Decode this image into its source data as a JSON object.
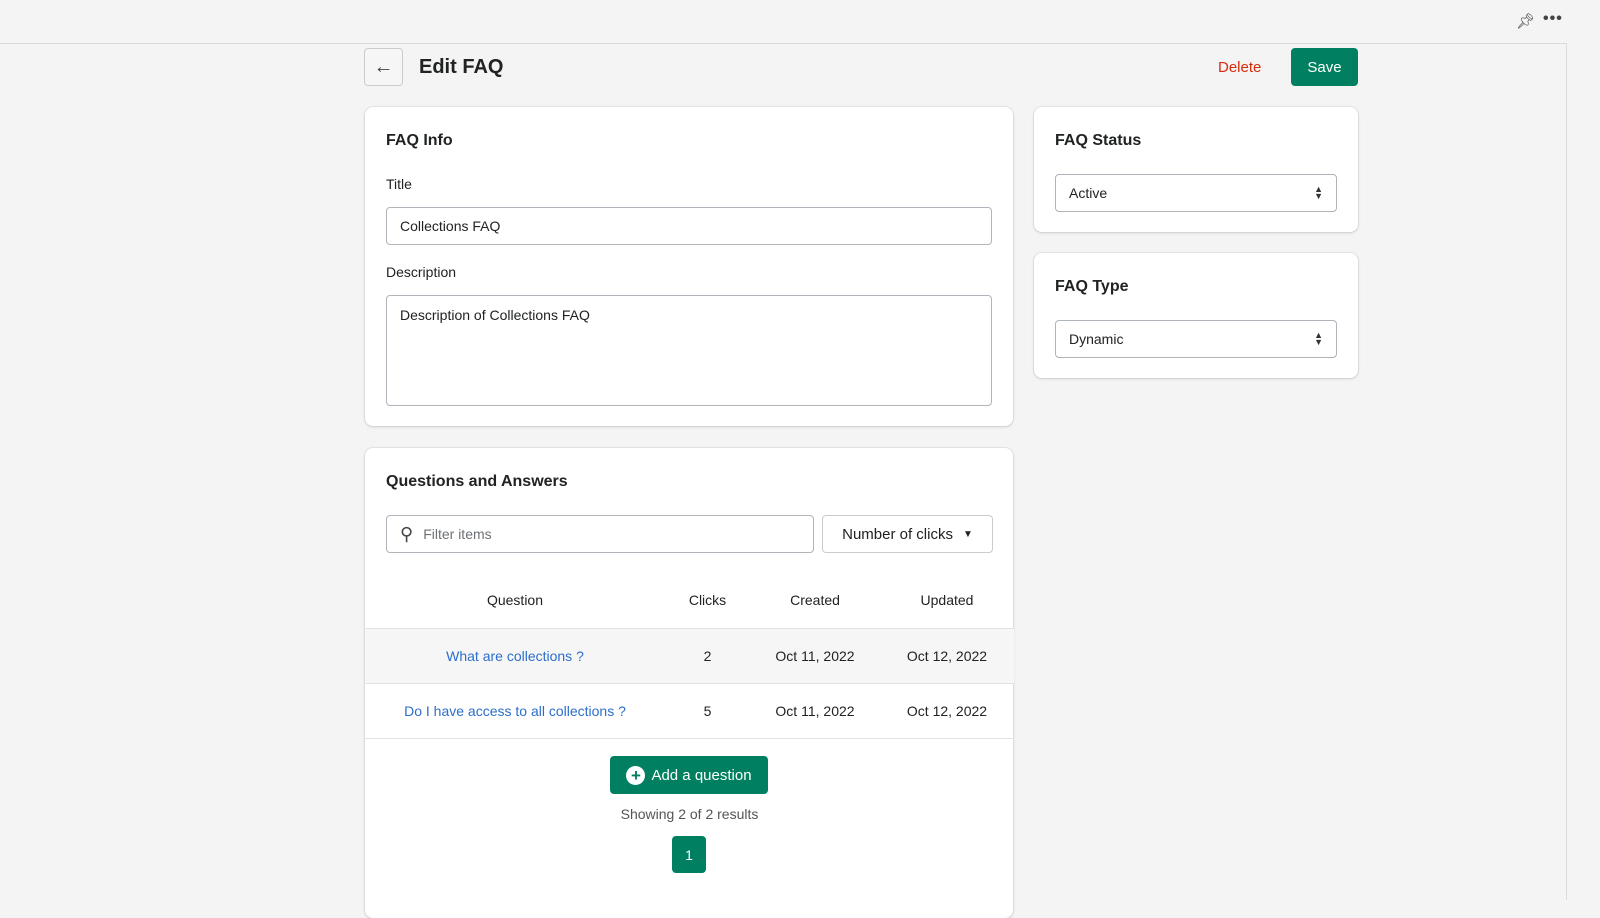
{
  "header": {
    "title": "Edit FAQ",
    "delete_label": "Delete",
    "save_label": "Save"
  },
  "faq_info": {
    "heading": "FAQ Info",
    "title_label": "Title",
    "title_value": "Collections FAQ",
    "description_label": "Description",
    "description_value": "Description of Collections FAQ"
  },
  "status": {
    "heading": "FAQ Status",
    "value": "Active"
  },
  "type": {
    "heading": "FAQ Type",
    "value": "Dynamic"
  },
  "qa": {
    "heading": "Questions and Answers",
    "filter_placeholder": "Filter items",
    "sort_label": "Number of clicks",
    "columns": [
      "Question",
      "Clicks",
      "Created",
      "Updated"
    ],
    "rows": [
      {
        "question": "What are collections ?",
        "clicks": "2",
        "created": "Oct 11, 2022",
        "updated": "Oct 12, 2022"
      },
      {
        "question": "Do I have access to all collections ?",
        "clicks": "5",
        "created": "Oct 11, 2022",
        "updated": "Oct 12, 2022"
      }
    ],
    "add_label": "Add a question",
    "showing": "Showing 2 of 2 results",
    "page": "1"
  },
  "colors": {
    "primary": "#008060",
    "danger": "#d72c0d",
    "link": "#2c6ecb"
  }
}
